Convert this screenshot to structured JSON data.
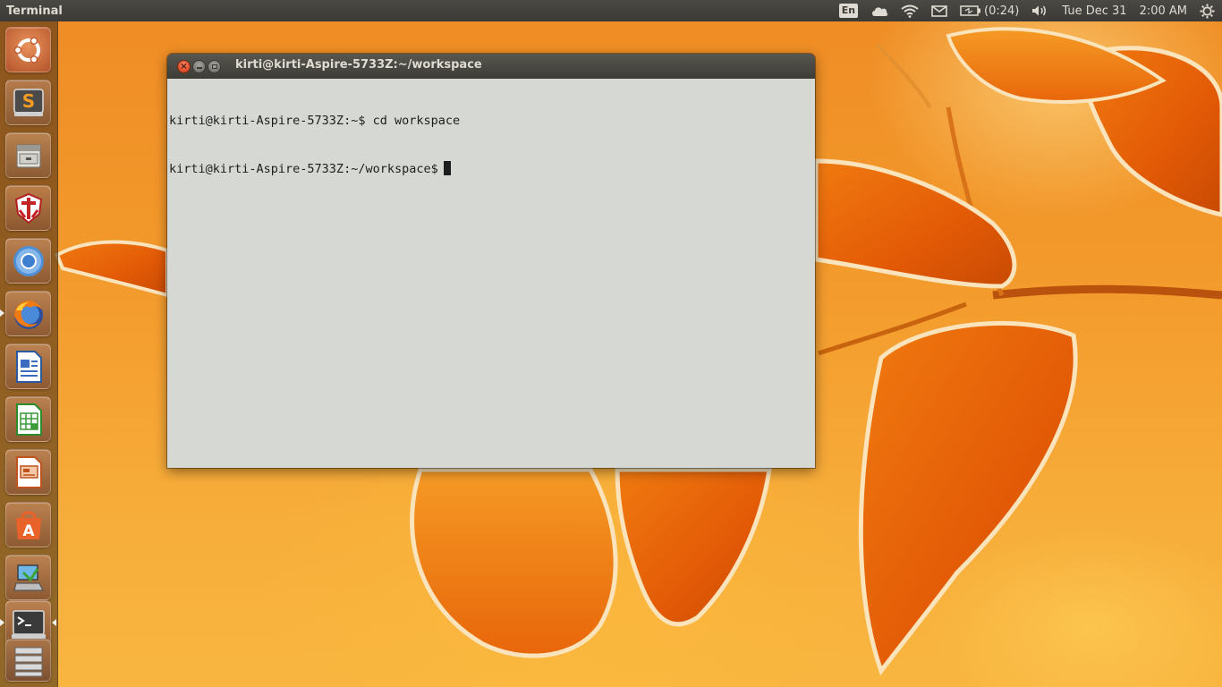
{
  "panel": {
    "app_title": "Terminal",
    "keyboard_layout": "En",
    "battery_time": "(0:24)",
    "date": "Tue Dec 31",
    "time": "2:00 AM",
    "icons": [
      "cloud-icon",
      "wifi-icon",
      "mail-icon",
      "battery-icon",
      "volume-icon",
      "power-gear-icon"
    ]
  },
  "launcher": {
    "items": [
      {
        "name": "dash-home",
        "icon": "ubuntu-logo-icon"
      },
      {
        "name": "sublime-text",
        "icon": "sublime-icon"
      },
      {
        "name": "file-manager",
        "icon": "file-cabinet-icon"
      },
      {
        "name": "app-shield",
        "icon": "shield-crest-icon"
      },
      {
        "name": "chromium",
        "icon": "chromium-icon"
      },
      {
        "name": "firefox",
        "icon": "firefox-icon"
      },
      {
        "name": "libreoffice-writer",
        "icon": "writer-icon"
      },
      {
        "name": "libreoffice-calc",
        "icon": "calc-icon"
      },
      {
        "name": "libreoffice-impress",
        "icon": "impress-icon"
      },
      {
        "name": "software-center",
        "icon": "software-center-icon"
      },
      {
        "name": "system-installer",
        "icon": "installer-icon"
      },
      {
        "name": "terminal",
        "icon": "terminal-icon"
      },
      {
        "name": "workspace-switcher",
        "icon": "workspaces-icon"
      }
    ]
  },
  "terminal": {
    "title": "kirti@kirti-Aspire-5733Z:~/workspace",
    "lines": [
      "kirti@kirti-Aspire-5733Z:~$ cd workspace",
      "kirti@kirti-Aspire-5733Z:~/workspace$"
    ]
  },
  "colors": {
    "panel_bg": "#3c3b37",
    "panel_text": "#dfdbd2",
    "terminal_bg": "#d5d8d3",
    "close_button": "#e2512b",
    "wallpaper_orange": "#f39a2c"
  }
}
